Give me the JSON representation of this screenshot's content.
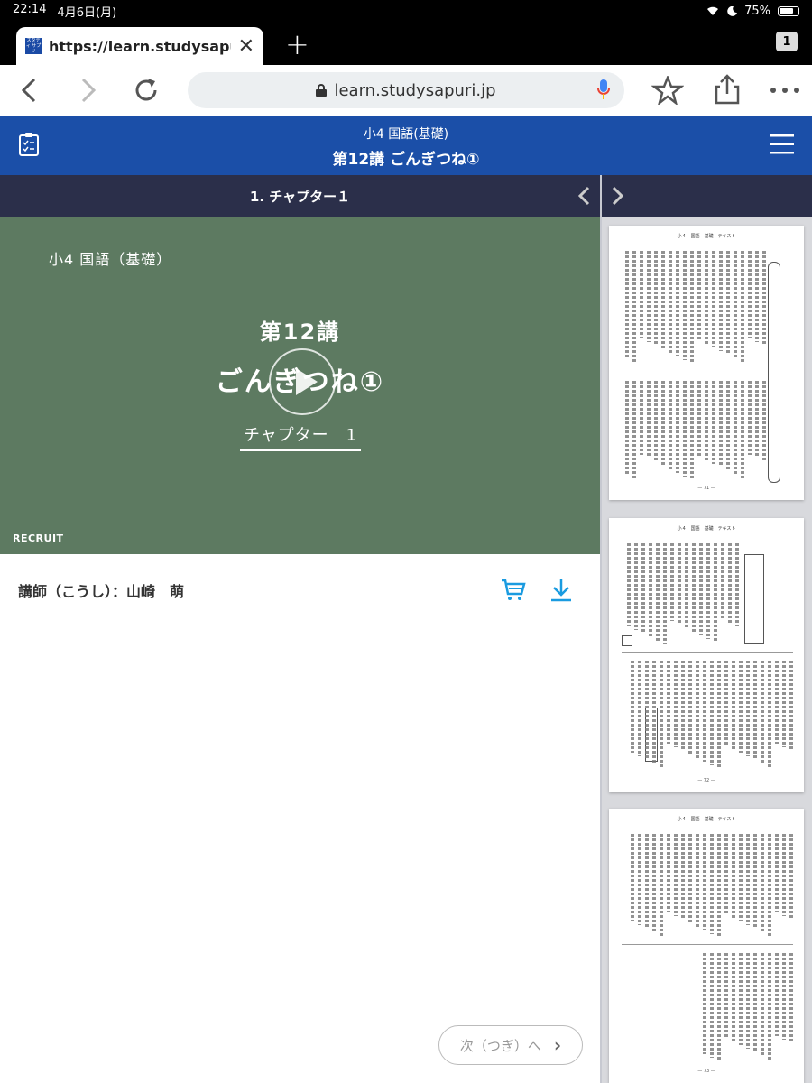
{
  "status_bar": {
    "time": "22:14",
    "date": "4月6日(月)",
    "battery": "75%"
  },
  "browser": {
    "tab_title": "https://learn.studysapuri.j",
    "favicon_text": "スタディ サプリ",
    "tab_count": "1",
    "url": "learn.studysapuri.jp"
  },
  "header": {
    "course": "小4 国語(基礎)",
    "lesson_title": "第12講 ごんぎつね①"
  },
  "chapter_bar": {
    "label": "1. チャプター１"
  },
  "video": {
    "course": "小4 国語（基礎）",
    "lesson": "第12講",
    "title": "ごんぎつね①",
    "chapter": "チャプター　1",
    "logo": "RECRUIT"
  },
  "instructor": "講師（こうし）：山崎　萌",
  "next_button": {
    "label": "次（つぎ）へ"
  },
  "pages": [
    {
      "header": "小４　国語　基礎　テキスト",
      "number": "— 71 —"
    },
    {
      "header": "小４　国語　基礎　テキスト",
      "number": "— 72 —"
    },
    {
      "header": "小４　国語　基礎　テキスト",
      "number": "— 73 —"
    }
  ],
  "icons": {
    "back": "chevron-left-icon",
    "forward": "chevron-right-icon",
    "reload": "reload-icon",
    "star": "star-icon",
    "share": "share-icon",
    "more": "more-icon",
    "cart": "cart-icon",
    "download": "download-icon"
  },
  "colors": {
    "header": "#1b4fa8",
    "chapter_bar": "#2b2f4a",
    "blackboard": "#5d7a61",
    "accent": "#1a9be0"
  }
}
